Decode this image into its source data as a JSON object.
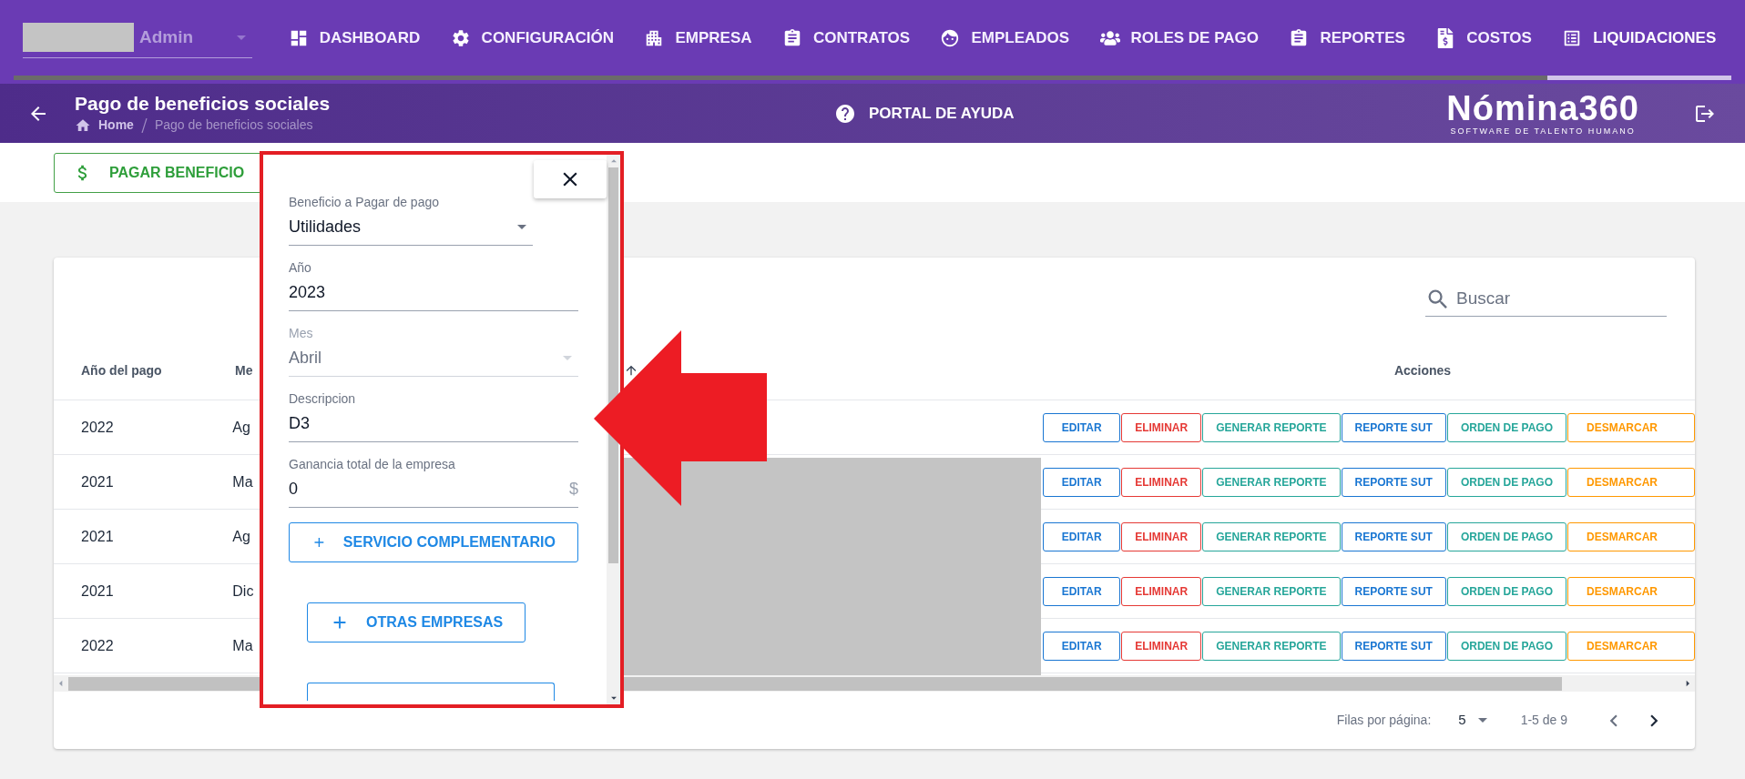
{
  "nav": {
    "user_role": "Admin",
    "tabs": [
      {
        "label": "DASHBOARD",
        "selected": false
      },
      {
        "label": "CONFIGURACIÓN",
        "selected": false
      },
      {
        "label": "EMPRESA",
        "selected": false
      },
      {
        "label": "CONTRATOS",
        "selected": false
      },
      {
        "label": "EMPLEADOS",
        "selected": false
      },
      {
        "label": "ROLES DE PAGO",
        "selected": false
      },
      {
        "label": "REPORTES",
        "selected": false
      },
      {
        "label": "COSTOS",
        "selected": false
      },
      {
        "label": "LIQUIDACIONES",
        "selected": true
      }
    ]
  },
  "subheader": {
    "title": "Pago de beneficios sociales",
    "breadcrumb": [
      "Home",
      "Pago de beneficios sociales"
    ],
    "help_link": "PORTAL DE AYUDA",
    "logo": {
      "name": "Nómina360",
      "tagline": "SOFTWARE DE TALENTO HUMANO"
    }
  },
  "toolbar": {
    "primary_button": "PAGAR BENEFICIO"
  },
  "table": {
    "search_placeholder": "Buscar",
    "columns": [
      "Año del pago",
      "Me"
    ],
    "actions_header": "Acciones",
    "rows": [
      {
        "year": "2022",
        "month": "Ag",
        "actions": [
          {
            "label": "EDITAR",
            "color": "#1976d2"
          },
          {
            "label": "ELIMINAR",
            "color": "#e53935"
          },
          {
            "label": "GENERAR REPORTE",
            "color": "#26a69a"
          },
          {
            "label": "REPORTE SUT",
            "color": "#1976d2"
          },
          {
            "label": "ORDEN DE PAGO",
            "color": "#26a69a"
          },
          {
            "label": "DESMARCAR",
            "color": "#ff9800"
          }
        ]
      },
      {
        "year": "2021",
        "month": "Ma",
        "actions": [
          {
            "label": "EDITAR",
            "color": "#1976d2"
          },
          {
            "label": "ELIMINAR",
            "color": "#e53935"
          },
          {
            "label": "GENERAR REPORTE",
            "color": "#26a69a"
          },
          {
            "label": "REPORTE SUT",
            "color": "#1976d2"
          },
          {
            "label": "ORDEN DE PAGO",
            "color": "#26a69a"
          },
          {
            "label": "DESMARCAR",
            "color": "#ff9800"
          }
        ]
      },
      {
        "year": "2021",
        "month": "Ag",
        "actions": [
          {
            "label": "EDITAR",
            "color": "#1976d2"
          },
          {
            "label": "ELIMINAR",
            "color": "#e53935"
          },
          {
            "label": "GENERAR REPORTE",
            "color": "#26a69a"
          },
          {
            "label": "REPORTE SUT",
            "color": "#1976d2"
          },
          {
            "label": "ORDEN DE PAGO",
            "color": "#26a69a"
          },
          {
            "label": "DESMARCAR",
            "color": "#ff9800"
          }
        ]
      },
      {
        "year": "2021",
        "month": "Dic",
        "actions": [
          {
            "label": "EDITAR",
            "color": "#1976d2"
          },
          {
            "label": "ELIMINAR",
            "color": "#e53935"
          },
          {
            "label": "GENERAR REPORTE",
            "color": "#26a69a"
          },
          {
            "label": "REPORTE SUT",
            "color": "#1976d2"
          },
          {
            "label": "ORDEN DE PAGO",
            "color": "#26a69a"
          },
          {
            "label": "DESMARCAR",
            "color": "#ff9800"
          }
        ]
      },
      {
        "year": "2022",
        "month": "Ma",
        "actions": [
          {
            "label": "EDITAR",
            "color": "#1976d2"
          },
          {
            "label": "ELIMINAR",
            "color": "#e53935"
          },
          {
            "label": "GENERAR REPORTE",
            "color": "#26a69a"
          },
          {
            "label": "REPORTE SUT",
            "color": "#1976d2"
          },
          {
            "label": "ORDEN DE PAGO",
            "color": "#26a69a"
          },
          {
            "label": "DESMARCAR",
            "color": "#ff9800"
          }
        ]
      }
    ]
  },
  "pagination": {
    "rows_per_page_label": "Filas por página:",
    "rows_per_page": "5",
    "range": "1-5 de 9"
  },
  "dialog": {
    "fields": [
      {
        "kind": "select",
        "label": "Beneficio a Pagar de pago",
        "value": "Utilidades",
        "disabled": false
      },
      {
        "kind": "text",
        "label": "Año",
        "value": "2023",
        "disabled": false
      },
      {
        "kind": "select",
        "label": "Mes",
        "value": "Abril",
        "disabled": true
      },
      {
        "kind": "text",
        "label": "Descripcion",
        "value": "D3",
        "disabled": false
      },
      {
        "kind": "text",
        "label": "Ganancia total de la empresa",
        "value": "0",
        "suffix": "$",
        "disabled": false
      }
    ],
    "buttons": [
      "SERVICIO COMPLEMENTARIO",
      "OTRAS EMPRESAS"
    ]
  }
}
